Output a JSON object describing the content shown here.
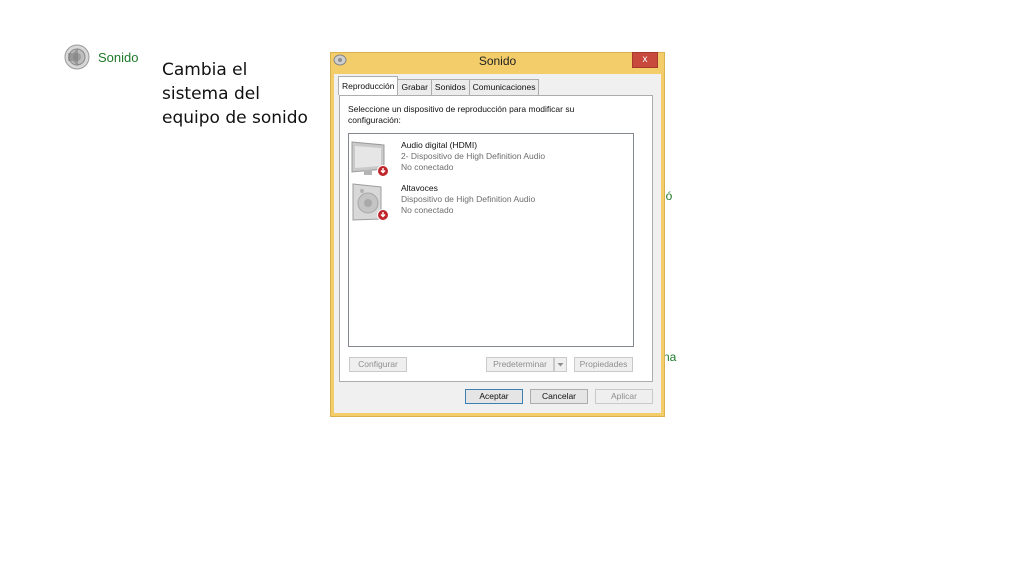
{
  "sidebar_link": {
    "label": "Sonido",
    "icon": "speaker-icon"
  },
  "caption": "Cambia el sistema del equipo de sonido",
  "background_fragments": [
    "ió",
    "na"
  ],
  "dialog": {
    "title": "Sonido",
    "close_glyph": "x",
    "tabs": [
      {
        "label": "Reproducción",
        "active": true
      },
      {
        "label": "Grabar",
        "active": false
      },
      {
        "label": "Sonidos",
        "active": false
      },
      {
        "label": "Comunicaciones",
        "active": false
      }
    ],
    "instructions": "Seleccione un dispositivo de reproducción para modificar su configuración:",
    "devices": [
      {
        "name": "Audio digital (HDMI)",
        "description": "2- Dispositivo de High Definition Audio",
        "status": "No conectado",
        "icon": "monitor-icon"
      },
      {
        "name": "Altavoces",
        "description": "Dispositivo de High Definition Audio",
        "status": "No conectado",
        "icon": "speaker-device-icon"
      }
    ],
    "buttons": {
      "configure": "Configurar",
      "set_default": "Predeterminar",
      "properties": "Propiedades",
      "ok": "Aceptar",
      "cancel": "Cancelar",
      "apply": "Aplicar"
    },
    "colors": {
      "frame": "#f2cd6a",
      "close": "#c74a3c",
      "link": "#1e7a2a"
    }
  }
}
